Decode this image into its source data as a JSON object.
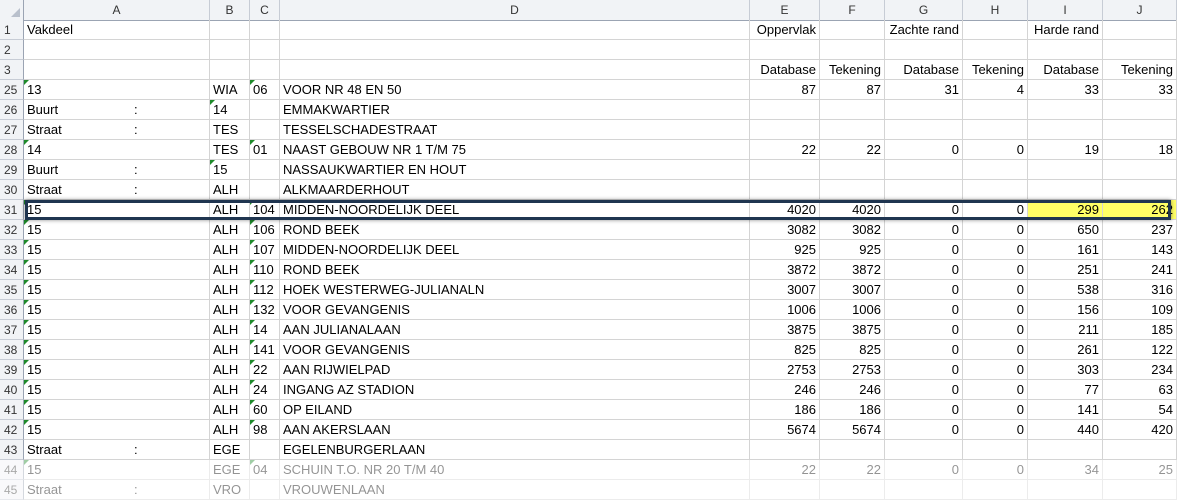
{
  "columns": [
    {
      "id": "A",
      "label": "A"
    },
    {
      "id": "B",
      "label": "B"
    },
    {
      "id": "C",
      "label": "C"
    },
    {
      "id": "D",
      "label": "D"
    },
    {
      "id": "E",
      "label": "E"
    },
    {
      "id": "F",
      "label": "F"
    },
    {
      "id": "G",
      "label": "G"
    },
    {
      "id": "H",
      "label": "H"
    },
    {
      "id": "I",
      "label": "I"
    },
    {
      "id": "J",
      "label": "J"
    }
  ],
  "rows": [
    {
      "n": "1",
      "A": "Vakdeel",
      "E": "Oppervlak",
      "G": "Zachte rand",
      "I": "Harde rand"
    },
    {
      "n": "2"
    },
    {
      "n": "3",
      "E": "Database",
      "F": "Tekening",
      "G": "Database",
      "H": "Tekening",
      "I": "Database",
      "J": "Tekening"
    },
    {
      "n": "25",
      "A": "13",
      "B": "WIA",
      "C": "06",
      "D": "VOOR NR 48 EN 50",
      "E": "87",
      "F": "87",
      "G": "31",
      "H": "4",
      "I": "33",
      "J": "33",
      "flagA": true,
      "flagC": true
    },
    {
      "n": "26",
      "A": "Buurt",
      "colon": ":",
      "B": "14",
      "D": "EMMAKWARTIER",
      "flagB": true
    },
    {
      "n": "27",
      "A": "Straat",
      "colon": ":",
      "B": "TES",
      "D": "TESSELSCHADESTRAAT"
    },
    {
      "n": "28",
      "A": "14",
      "B": "TES",
      "C": "01",
      "D": "NAAST GEBOUW NR 1 T/M 75",
      "E": "22",
      "F": "22",
      "G": "0",
      "H": "0",
      "I": "19",
      "J": "18",
      "flagA": true,
      "flagC": true
    },
    {
      "n": "29",
      "A": "Buurt",
      "colon": ":",
      "B": "15",
      "D": "NASSAUKWARTIER EN HOUT",
      "flagB": true
    },
    {
      "n": "30",
      "A": "Straat",
      "colon": ":",
      "B": "ALH",
      "D": "ALKMAARDERHOUT"
    },
    {
      "n": "31",
      "A": "15",
      "B": "ALH",
      "C": "104",
      "D": "MIDDEN-NOORDELIJK DEEL",
      "E": "4020",
      "F": "4020",
      "G": "0",
      "H": "0",
      "I": "299",
      "J": "262",
      "flagA": true,
      "flagC": true,
      "selected": true,
      "highlight": [
        "I",
        "J"
      ]
    },
    {
      "n": "32",
      "A": "15",
      "B": "ALH",
      "C": "106",
      "D": "ROND BEEK",
      "E": "3082",
      "F": "3082",
      "G": "0",
      "H": "0",
      "I": "650",
      "J": "237",
      "flagA": true,
      "flagC": true
    },
    {
      "n": "33",
      "A": "15",
      "B": "ALH",
      "C": "107",
      "D": "MIDDEN-NOORDELIJK DEEL",
      "E": "925",
      "F": "925",
      "G": "0",
      "H": "0",
      "I": "161",
      "J": "143",
      "flagA": true,
      "flagC": true
    },
    {
      "n": "34",
      "A": "15",
      "B": "ALH",
      "C": "110",
      "D": "ROND BEEK",
      "E": "3872",
      "F": "3872",
      "G": "0",
      "H": "0",
      "I": "251",
      "J": "241",
      "flagA": true,
      "flagC": true
    },
    {
      "n": "35",
      "A": "15",
      "B": "ALH",
      "C": "112",
      "D": "HOEK WESTERWEG-JULIANALN",
      "E": "3007",
      "F": "3007",
      "G": "0",
      "H": "0",
      "I": "538",
      "J": "316",
      "flagA": true,
      "flagC": true
    },
    {
      "n": "36",
      "A": "15",
      "B": "ALH",
      "C": "132",
      "D": "VOOR GEVANGENIS",
      "E": "1006",
      "F": "1006",
      "G": "0",
      "H": "0",
      "I": "156",
      "J": "109",
      "flagA": true,
      "flagC": true
    },
    {
      "n": "37",
      "A": "15",
      "B": "ALH",
      "C": "14",
      "D": "AAN JULIANALAAN",
      "E": "3875",
      "F": "3875",
      "G": "0",
      "H": "0",
      "I": "211",
      "J": "185",
      "flagA": true,
      "flagC": true
    },
    {
      "n": "38",
      "A": "15",
      "B": "ALH",
      "C": "141",
      "D": "VOOR GEVANGENIS",
      "E": "825",
      "F": "825",
      "G": "0",
      "H": "0",
      "I": "261",
      "J": "122",
      "flagA": true,
      "flagC": true
    },
    {
      "n": "39",
      "A": "15",
      "B": "ALH",
      "C": "22",
      "D": "AAN RIJWIELPAD",
      "E": "2753",
      "F": "2753",
      "G": "0",
      "H": "0",
      "I": "303",
      "J": "234",
      "flagA": true,
      "flagC": true
    },
    {
      "n": "40",
      "A": "15",
      "B": "ALH",
      "C": "24",
      "D": "INGANG AZ STADION",
      "E": "246",
      "F": "246",
      "G": "0",
      "H": "0",
      "I": "77",
      "J": "63",
      "flagA": true,
      "flagC": true
    },
    {
      "n": "41",
      "A": "15",
      "B": "ALH",
      "C": "60",
      "D": "OP EILAND",
      "E": "186",
      "F": "186",
      "G": "0",
      "H": "0",
      "I": "141",
      "J": "54",
      "flagA": true,
      "flagC": true
    },
    {
      "n": "42",
      "A": "15",
      "B": "ALH",
      "C": "98",
      "D": "AAN AKERSLAAN",
      "E": "5674",
      "F": "5674",
      "G": "0",
      "H": "0",
      "I": "440",
      "J": "420",
      "flagA": true,
      "flagC": true
    },
    {
      "n": "43",
      "A": "Straat",
      "colon": ":",
      "B": "EGE",
      "D": "EGELENBURGERLAAN"
    },
    {
      "n": "44",
      "A": "15",
      "B": "EGE",
      "C": "04",
      "D": "SCHUIN T.O. NR 20 T/M 40",
      "E": "22",
      "F": "22",
      "G": "0",
      "H": "0",
      "I": "34",
      "J": "25",
      "flagA": true,
      "flagC": true,
      "faded": true
    },
    {
      "n": "45",
      "A": "Straat",
      "colon": ":",
      "B": "VRO",
      "D": "VROUWENLAAN",
      "faded": true
    }
  ],
  "colors": {
    "highlight": "#ffff66",
    "selection_border": "#1f3550",
    "comment_flag": "#1e8a2a"
  }
}
